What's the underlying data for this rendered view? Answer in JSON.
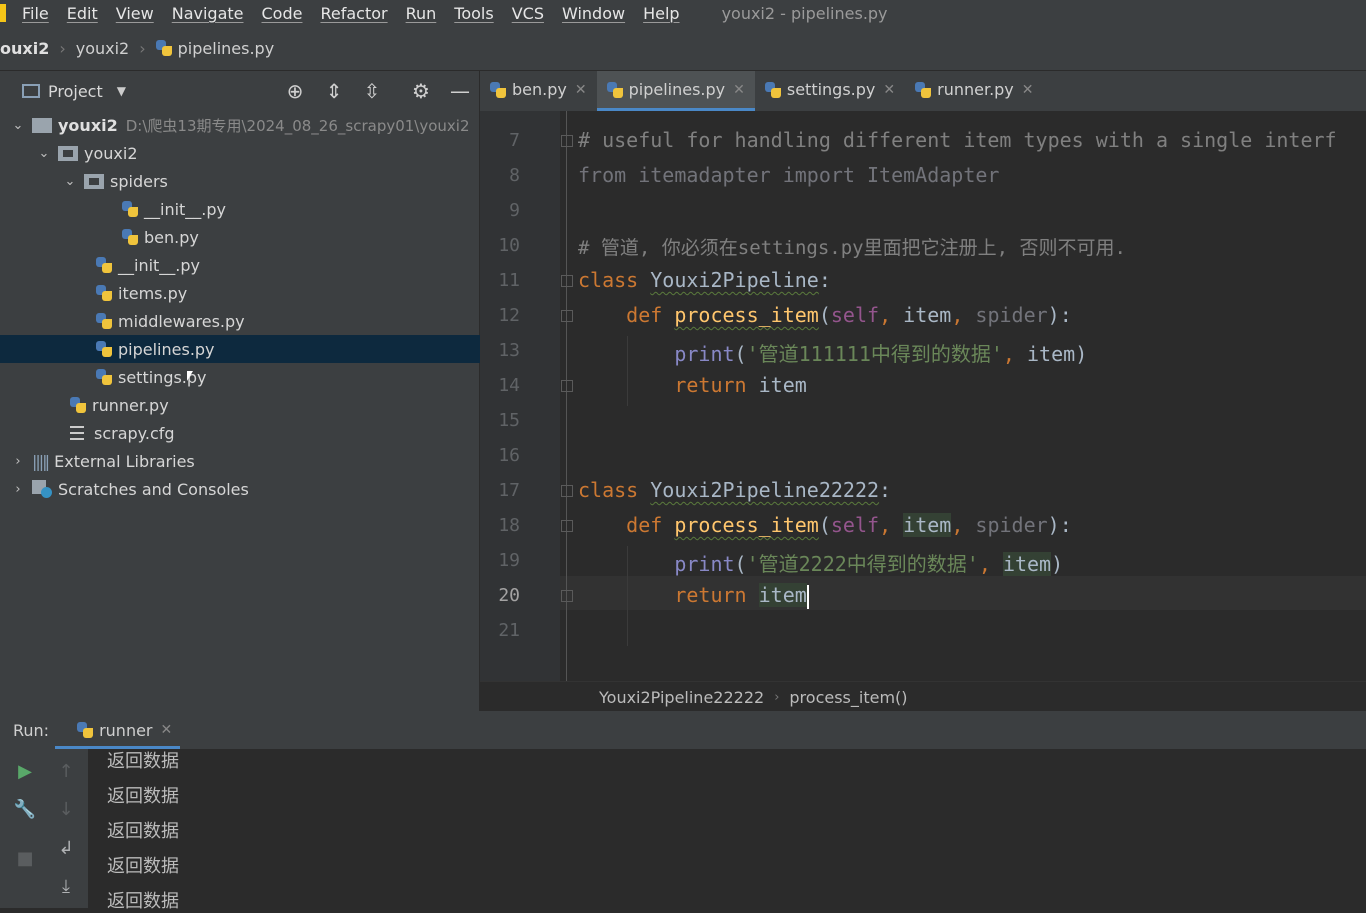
{
  "menu": {
    "items": [
      "File",
      "Edit",
      "View",
      "Navigate",
      "Code",
      "Refactor",
      "Run",
      "Tools",
      "VCS",
      "Window",
      "Help"
    ],
    "window_title": "youxi2 - pipelines.py"
  },
  "navbar": {
    "crumbs": [
      "ouxi2",
      "youxi2",
      "pipelines.py"
    ]
  },
  "project_panel": {
    "title": "Project",
    "tree": [
      {
        "label": "youxi2",
        "path": "D:\\爬虫13期专用\\2024_08_26_scrapy01\\youxi2"
      },
      {
        "label": "youxi2"
      },
      {
        "label": "spiders"
      },
      {
        "label": "__init__.py"
      },
      {
        "label": "ben.py"
      },
      {
        "label": "__init__.py"
      },
      {
        "label": "items.py"
      },
      {
        "label": "middlewares.py"
      },
      {
        "label": "pipelines.py"
      },
      {
        "label": "settings.py"
      },
      {
        "label": "runner.py"
      },
      {
        "label": "scrapy.cfg"
      },
      {
        "label": "External Libraries"
      },
      {
        "label": "Scratches and Consoles"
      }
    ]
  },
  "tabs": [
    {
      "label": "ben.py"
    },
    {
      "label": "pipelines.py"
    },
    {
      "label": "settings.py"
    },
    {
      "label": "runner.py"
    }
  ],
  "editor": {
    "line_numbers": [
      "7",
      "8",
      "9",
      "10",
      "11",
      "12",
      "13",
      "14",
      "15",
      "16",
      "17",
      "18",
      "19",
      "20",
      "21"
    ],
    "code": {
      "l7": "# useful for handling different item types with a single interf",
      "l8_kw": "from",
      "l8_mod": " itemadapter ",
      "l8_kw2": "import",
      "l8_name": " ItemAdapter",
      "l10": "# 管道, 你必须在settings.py里面把它注册上, 否则不可用.",
      "kw_class": "class",
      "kw_def": "def",
      "kw_return": "return",
      "class1": "Youxi2Pipeline",
      "class2": "Youxi2Pipeline22222",
      "fn": "process_item",
      "self": "self",
      "item": "item",
      "spider": "spider",
      "print": "print",
      "str1": "'管道111111中得到的数据'",
      "str2": "'管道2222中得到的数据'"
    }
  },
  "editor_breadcrumb": {
    "items": [
      "Youxi2Pipeline22222",
      "process_item()"
    ]
  },
  "run": {
    "label": "Run:",
    "tab": "runner",
    "output": [
      "返回数据",
      "返回数据",
      "返回数据",
      "返回数据",
      "返回数据"
    ]
  }
}
